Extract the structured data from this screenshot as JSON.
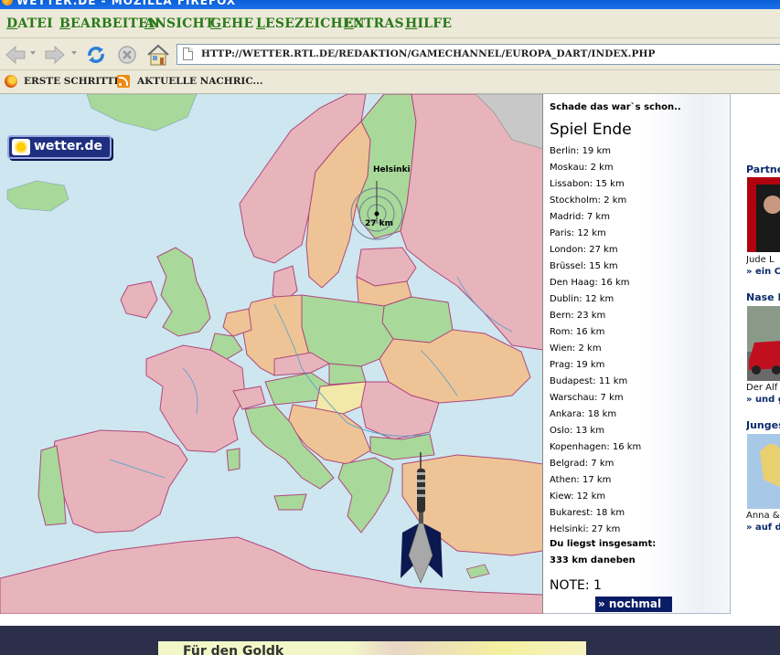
{
  "window": {
    "title": "wetter.de - Mozilla Firefox"
  },
  "menu": {
    "items": [
      "Datei",
      "Bearbeiten",
      "Ansicht",
      "Gehe",
      "Lesezeichen",
      "Extras",
      "Hilfe"
    ]
  },
  "navbar": {
    "url": "http://wetter.rtl.de/redaktion/gamechannel/europa_dart/index.php",
    "icons": [
      "back-arrow-icon",
      "forward-arrow-icon",
      "reload-icon",
      "stop-icon",
      "home-icon",
      "page-icon"
    ]
  },
  "bookmarks": {
    "items": [
      "Erste Schritte",
      "Aktuelle Nachric..."
    ]
  },
  "map": {
    "logo_text": "wetter.de",
    "target_label": "Helsinki",
    "distance_label": "27 km"
  },
  "results": {
    "header": "Schade das war`s schon..",
    "title": "Spiel Ende",
    "list": [
      "Berlin: 19 km",
      "Moskau: 2 km",
      "Lissabon: 15 km",
      "Stockholm: 2 km",
      "Madrid: 7 km",
      "Paris: 12 km",
      "London: 27 km",
      "Brüssel: 15 km",
      "Den Haag: 16 km",
      "Dublin: 12 km",
      "Bern: 23 km",
      "Rom: 16 km",
      "Wien: 2 km",
      "Prag: 19 km",
      "Budapest: 11 km",
      "Warschau: 7 km",
      "Ankara: 18 km",
      "Oslo: 13 km",
      "Kopenhagen: 16 km",
      "Belgrad: 7 km",
      "Athen: 17 km",
      "Kiew: 12 km",
      "Bukarest: 18 km",
      "Helsinki: 27 km"
    ],
    "total_label": "Du liegst insgesamt:",
    "total_value": "333  km daneben",
    "note": "NOTE: 1",
    "again_button": "» nochmal"
  },
  "sidebar": {
    "sections": [
      {
        "head": "Partne",
        "caption": "Jude L",
        "link": "» ein C"
      },
      {
        "head": "Nase K",
        "caption": "Der Alf",
        "link": "» und g"
      },
      {
        "head": "Junges",
        "caption": "Anna &",
        "link": "» auf d"
      }
    ]
  },
  "footer": {
    "banner_text": "Für den Goldk"
  },
  "colors": {
    "sea": "#cde6ef",
    "land_pink": "#e8b4bc",
    "land_orange": "#eec496",
    "land_green": "#a8d99a",
    "land_yellow": "#f2e8a8",
    "menu_green": "#2a7a1a",
    "button_navy": "#0b1c66"
  }
}
